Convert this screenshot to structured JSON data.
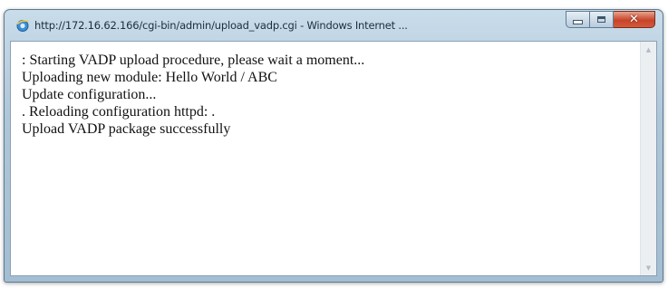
{
  "window": {
    "title": "http://172.16.62.166/cgi-bin/admin/upload_vadp.cgi - Windows Internet ..."
  },
  "icons": {
    "browser": "ie-icon",
    "minimize": "minimize-icon",
    "maximize": "maximize-icon",
    "close": "close-icon",
    "scroll_up": "scroll-up-arrow-icon",
    "scroll_down": "scroll-down-arrow-icon"
  },
  "output_lines": [
    ": Starting VADP upload procedure, please wait a moment...",
    "Uploading new module: Hello World / ABC",
    "Update configuration...",
    ". Reloading configuration httpd: .",
    "Upload VADP package successfully"
  ],
  "colors": {
    "close_button": "#c7442a",
    "titlebar": "#aec6d9"
  }
}
